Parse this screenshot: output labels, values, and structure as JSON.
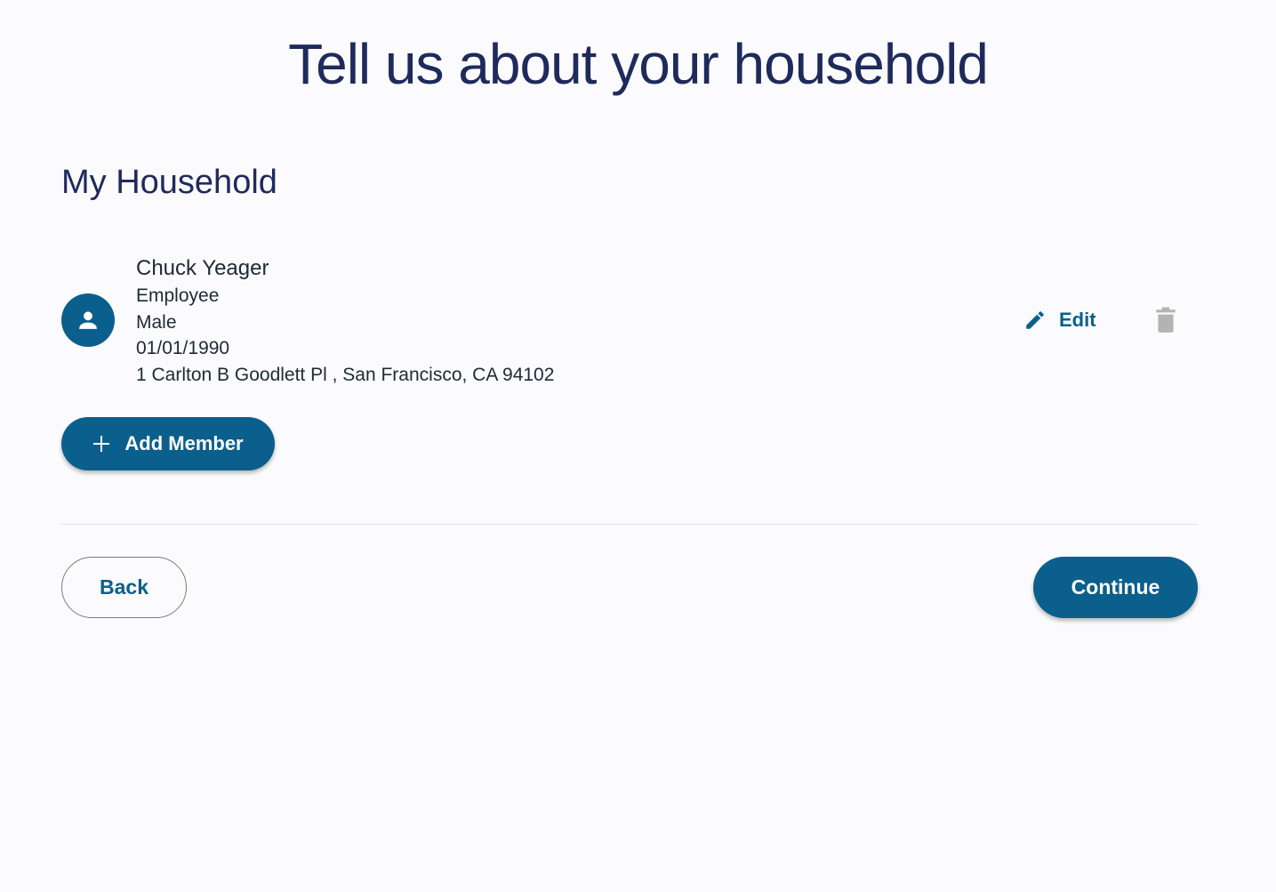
{
  "header": {
    "title": "Tell us about your household"
  },
  "household": {
    "section_title": "My Household",
    "members": [
      {
        "name": "Chuck Yeager",
        "role": "Employee",
        "gender": "Male",
        "dob": "01/01/1990",
        "address": "1 Carlton B Goodlett Pl , San Francisco, CA 94102",
        "avatar_icon": "person-icon",
        "edit_label": "Edit",
        "edit_icon": "pencil-icon",
        "delete_icon": "trash-icon"
      }
    ],
    "add_member_label": "Add Member",
    "add_member_icon": "plus-icon"
  },
  "footer": {
    "back_label": "Back",
    "continue_label": "Continue"
  },
  "colors": {
    "primary": "#0b5f8c",
    "title": "#1f2a5c",
    "background": "#fbfbfd",
    "delete_icon": "#b3b3b3"
  }
}
